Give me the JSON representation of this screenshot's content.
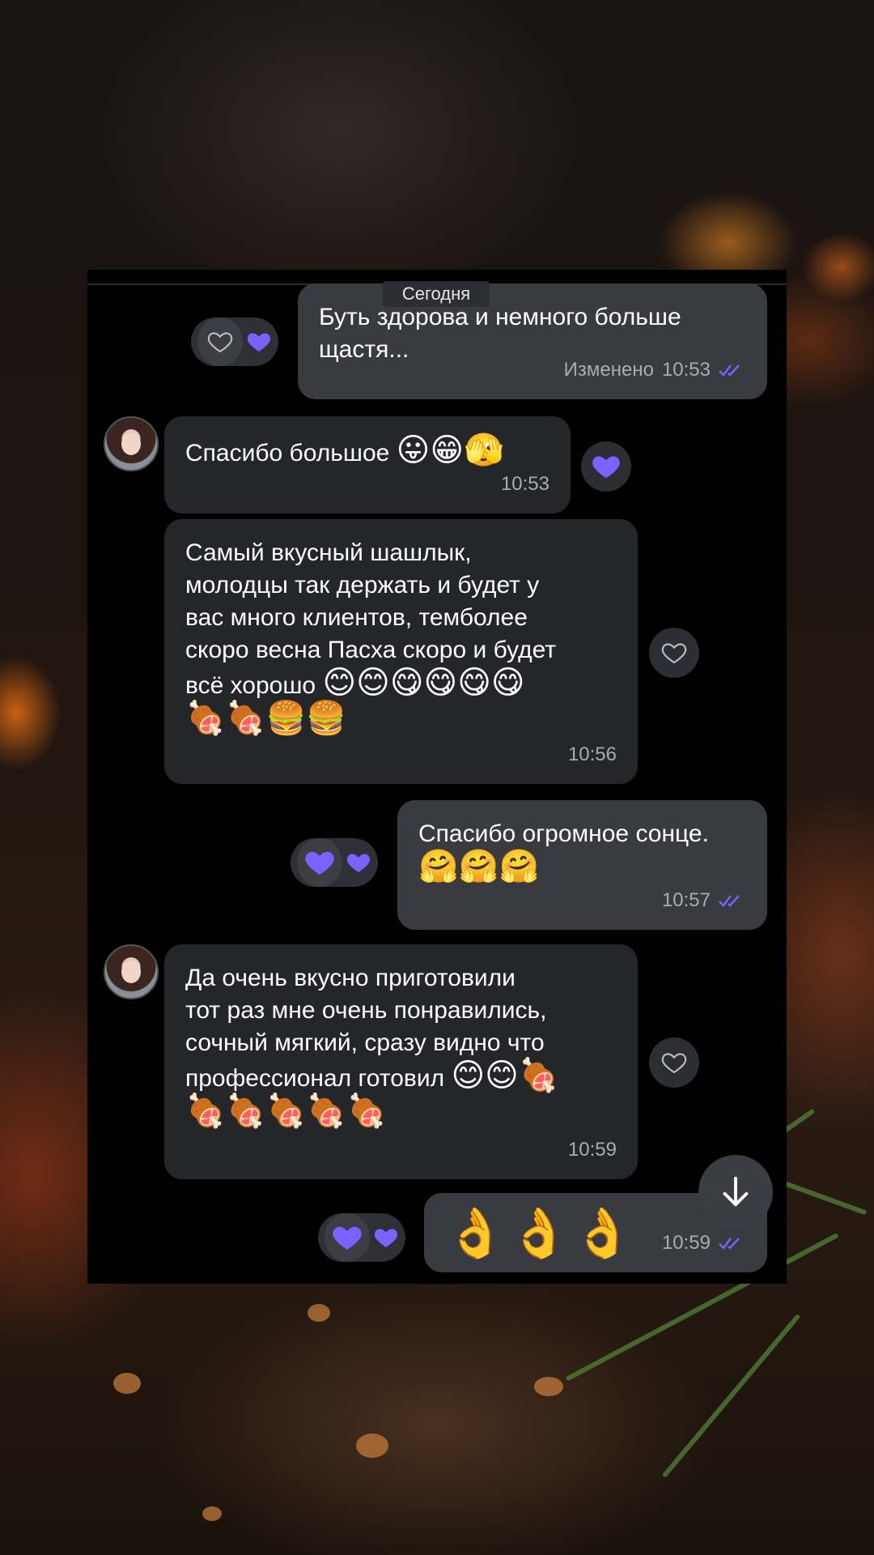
{
  "date_divider": "Сегодня",
  "messages": [
    {
      "text": "Буть здорова и немного больше\nщастя...",
      "edited": "Изменено",
      "time": "10:53"
    },
    {
      "text": "Спасибо большое ",
      "emoji": "😛😁🫣",
      "time": "10:53"
    },
    {
      "text": "Самый вкусный шашлык,\nмолодцы так держать и будет у\nвас много клиентов, темболее\nскоро весна Пасха скоро и будет\nвсё хорошо ",
      "emoji": "😊😊😋😋😋😋\n🍖🍖🍔🍔",
      "time": "10:56"
    },
    {
      "text": "Спасибо огромное сонце.",
      "emoji": "🤗🤗🤗",
      "time": "10:57"
    },
    {
      "text": "Да очень вкусно приготовили\nтот раз мне очень понравились,\nсочный мягкий, сразу видно что\nпрофессионал готовил ",
      "emoji": "😊😊🍖\n🍖🍖🍖🍖🍖",
      "time": "10:59"
    },
    {
      "emoji": "👌👌👌",
      "time": "10:59"
    }
  ],
  "colors": {
    "accent": "#7b61ff",
    "outgoing_bubble": "#3a3b40",
    "incoming_bubble": "#25262a"
  },
  "icons": {
    "reaction": "heart-icon",
    "read": "double-check-icon",
    "scroll": "arrow-down-icon"
  }
}
